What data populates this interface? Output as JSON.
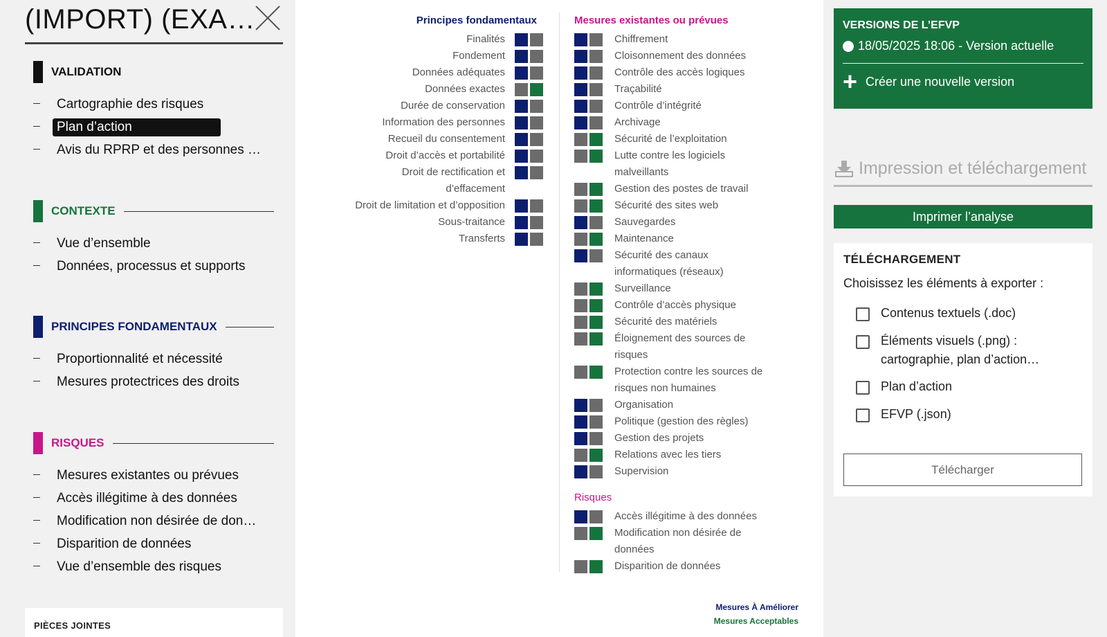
{
  "sidebar": {
    "app_title": "(IMPORT) (EXA…",
    "sections": {
      "validation": {
        "label": "VALIDATION",
        "color": "#111111",
        "items": [
          "Cartographie des risques",
          "Plan d’action",
          "Avis du RPRP et des personnes …"
        ]
      },
      "contexte": {
        "label": "CONTEXTE",
        "color": "#17733d",
        "items": [
          "Vue d’ensemble",
          "Données, processus et supports"
        ]
      },
      "principes": {
        "label": "PRINCIPES FONDAMENTAUX",
        "color": "#0c1e6e",
        "items": [
          "Proportionnalité et nécessité",
          "Mesures protectrices des droits"
        ]
      },
      "risques": {
        "label": "RISQUES",
        "color": "#c8168a",
        "items": [
          "Mesures existantes ou prévues",
          "Accès illégitime à des données",
          "Modification non désirée de don…",
          "Disparition de données",
          "Vue d’ensemble des risques"
        ]
      }
    },
    "active_item": "Plan d’action",
    "attachments_title": "PIÈCES JOINTES"
  },
  "action_plan": {
    "colors": {
      "improve": "#0c1e6e",
      "acceptable": "#17733d",
      "neutral": "#6b6b6b"
    },
    "principes": {
      "title": "Principes fondamentaux",
      "items": [
        {
          "label": "Finalités",
          "status": "improve"
        },
        {
          "label": "Fondement",
          "status": "improve"
        },
        {
          "label": "Données adéquates",
          "status": "improve"
        },
        {
          "label": "Données exactes",
          "status": "acceptable"
        },
        {
          "label": "Durée de conservation",
          "status": "improve"
        },
        {
          "label": "Information des personnes",
          "status": "improve"
        },
        {
          "label": "Recueil du consentement",
          "status": "improve"
        },
        {
          "label": "Droit d’accès et portabilité",
          "status": "improve"
        },
        {
          "label": "Droit de rectification et d’effacement",
          "status": "improve"
        },
        {
          "label": "Droit de limitation et d’opposition",
          "status": "improve"
        },
        {
          "label": "Sous-traitance",
          "status": "improve"
        },
        {
          "label": "Transferts",
          "status": "improve"
        }
      ]
    },
    "mesures": {
      "title": "Mesures existantes ou prévues",
      "items": [
        {
          "label": "Chiffrement",
          "status": "improve"
        },
        {
          "label": "Cloisonnement des données",
          "status": "improve"
        },
        {
          "label": "Contrôle des accès logiques",
          "status": "improve"
        },
        {
          "label": "Traçabilité",
          "status": "improve"
        },
        {
          "label": "Contrôle d’intégrité",
          "status": "improve"
        },
        {
          "label": "Archivage",
          "status": "improve"
        },
        {
          "label": "Sécurité de l’exploitation",
          "status": "acceptable"
        },
        {
          "label": "Lutte contre les logiciels malveillants",
          "status": "acceptable"
        },
        {
          "label": "Gestion des postes de travail",
          "status": "acceptable"
        },
        {
          "label": "Sécurité des sites web",
          "status": "acceptable"
        },
        {
          "label": "Sauvegardes",
          "status": "improve"
        },
        {
          "label": "Maintenance",
          "status": "acceptable"
        },
        {
          "label": "Sécurité des canaux informatiques (réseaux)",
          "status": "improve"
        },
        {
          "label": "Surveillance",
          "status": "acceptable"
        },
        {
          "label": "Contrôle d’accès physique",
          "status": "acceptable"
        },
        {
          "label": "Sécurité des matériels",
          "status": "acceptable"
        },
        {
          "label": "Éloignement des sources de risques",
          "status": "acceptable"
        },
        {
          "label": "Protection contre les sources de risques non humaines",
          "status": "acceptable"
        },
        {
          "label": "Organisation",
          "status": "improve"
        },
        {
          "label": "Politique (gestion des règles)",
          "status": "improve"
        },
        {
          "label": "Gestion des projets",
          "status": "improve"
        },
        {
          "label": "Relations avec les tiers",
          "status": "acceptable"
        },
        {
          "label": "Supervision",
          "status": "improve"
        }
      ]
    },
    "risques": {
      "title": "Risques",
      "items": [
        {
          "label": "Accès illégitime à des données",
          "status": "improve"
        },
        {
          "label": "Modification non désirée de données",
          "status": "acceptable"
        },
        {
          "label": "Disparition de données",
          "status": "acceptable"
        }
      ]
    },
    "legend": {
      "improve": "Mesures À Améliorer",
      "acceptable": "Mesures Acceptables"
    }
  },
  "right_panel": {
    "versions_title": "VERSIONS DE L’EFVP",
    "current_version": "18/05/2025 18:06 - Version actuelle",
    "new_version_label": "Créer une nouvelle version",
    "print_heading": "Impression et téléchargement",
    "print_button": "Imprimer l’analyse",
    "download_title": "TÉLÉCHARGEMENT",
    "download_subtitle": "Choisissez les éléments à exporter :",
    "download_options": [
      "Contenus textuels (.doc)",
      "Éléments visuels (.png) : cartographie, plan d’action…",
      "Plan d’action",
      "EFVP (.json)"
    ],
    "download_button": "Télécharger"
  }
}
